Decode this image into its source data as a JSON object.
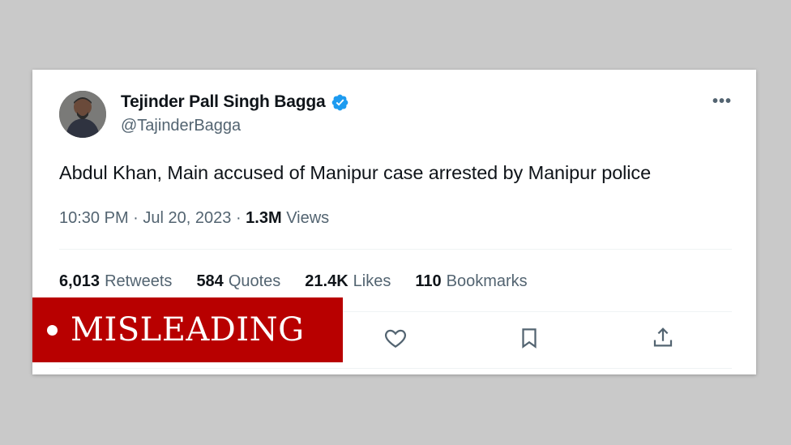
{
  "tweet": {
    "display_name": "Tejinder Pall Singh Bagga",
    "handle": "@TajinderBagga",
    "text": "Abdul Khan, Main accused of Manipur case arrested by Manipur police",
    "time": "10:30 PM",
    "date": "Jul 20, 2023",
    "views_count": "1.3M",
    "views_label": "Views",
    "more_label": "•••",
    "verified_icon": "verified-badge-icon",
    "colors": {
      "verified": "#1d9bf0",
      "text": "#0f1419",
      "muted": "#536471"
    }
  },
  "stats": {
    "retweets_count": "6,013",
    "retweets_label": "Retweets",
    "quotes_count": "584",
    "quotes_label": "Quotes",
    "likes_count": "21.4K",
    "likes_label": "Likes",
    "bookmarks_count": "110",
    "bookmarks_label": "Bookmarks"
  },
  "actions": [
    "heart-icon",
    "bookmark-icon",
    "share-icon"
  ],
  "banner": {
    "label": "MISLEADING",
    "color": "#b80000"
  }
}
